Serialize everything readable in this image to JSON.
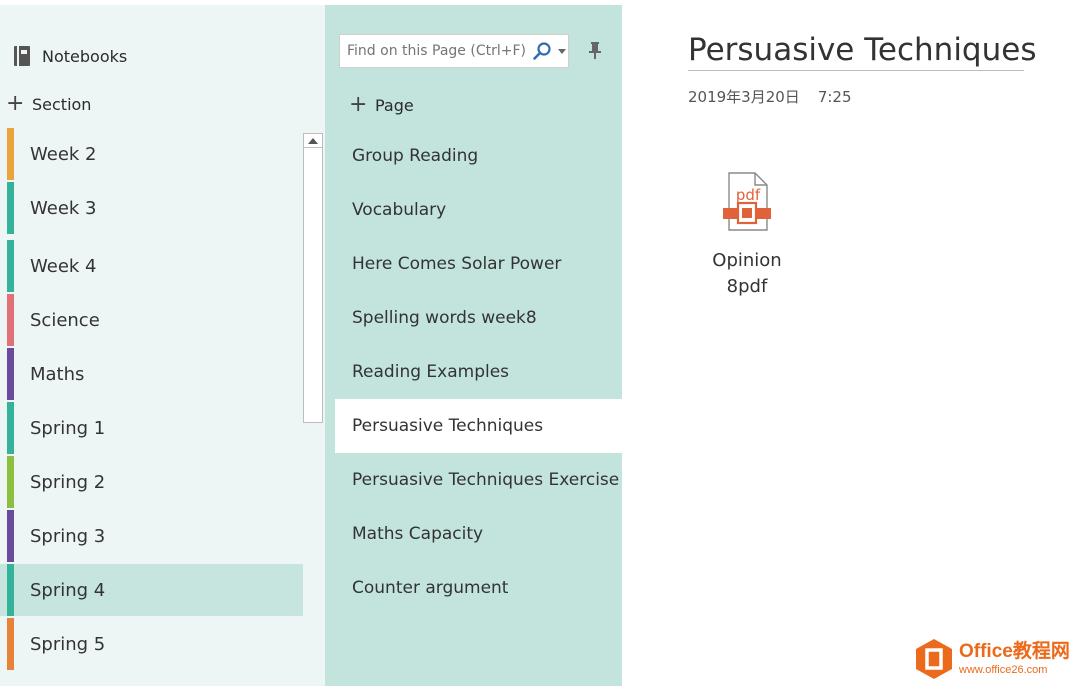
{
  "sidebar": {
    "notebooks_label": "Notebooks",
    "add_section_label": "Section",
    "sections": [
      {
        "label": "Week 2",
        "color": "#e9a43b"
      },
      {
        "label": "Week 3",
        "color": "#34b39a"
      },
      {
        "label": "Week 4",
        "color": "#34b39a"
      },
      {
        "label": "Science",
        "color": "#e07178"
      },
      {
        "label": "Maths",
        "color": "#6b4a9e"
      },
      {
        "label": "Spring 1",
        "color": "#34b39a"
      },
      {
        "label": "Spring 2",
        "color": "#8cbf3f"
      },
      {
        "label": "Spring 3",
        "color": "#6b4a9e"
      },
      {
        "label": "Spring 4",
        "color": "#34b39a",
        "selected": true
      },
      {
        "label": "Spring 5",
        "color": "#e8813a"
      }
    ]
  },
  "pages_pane": {
    "search_placeholder": "Find on this Page (Ctrl+F)",
    "add_page_label": "Page",
    "pages": [
      {
        "label": "Group Reading"
      },
      {
        "label": "Vocabulary"
      },
      {
        "label": "Here Comes Solar Power"
      },
      {
        "label": "Spelling words week8"
      },
      {
        "label": "Reading Examples"
      },
      {
        "label": "Persuasive Techniques",
        "selected": true
      },
      {
        "label": "Persuasive Techniques Exercise"
      },
      {
        "label": "Maths Capacity"
      },
      {
        "label": "Counter argument"
      }
    ]
  },
  "content": {
    "title": "Persuasive Techniques",
    "date": "2019年3月20日",
    "time": "7:25",
    "attachment": {
      "name_line1": "Opinion",
      "name_line2": "8pdf",
      "icon_label": "pdf",
      "icon": "pdf-file-icon"
    }
  },
  "watermark": {
    "title": "Office教程网",
    "url": "www.office26.com"
  },
  "colors": {
    "sections_bg": "#eef6f5",
    "pages_bg": "#c2e4dd",
    "selected_section_bg": "#c5e5de",
    "pdf_accent": "#e0623a",
    "watermark_accent": "#ec6a1c"
  }
}
